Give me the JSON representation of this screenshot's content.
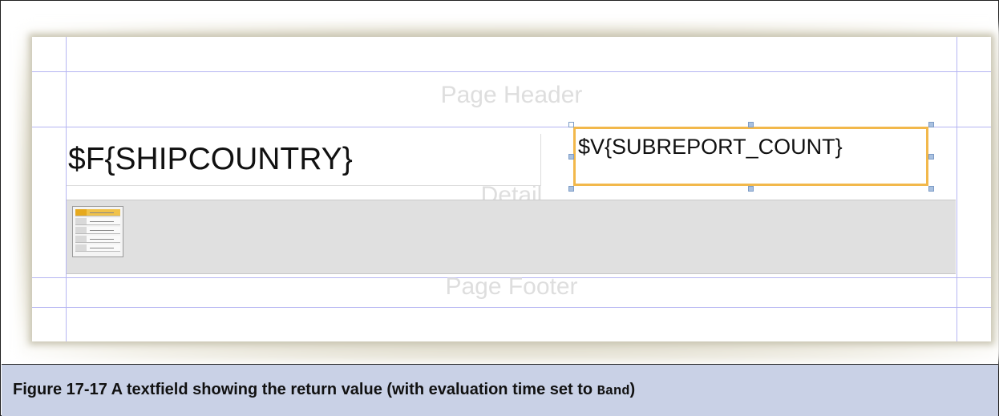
{
  "designer": {
    "bands": {
      "page_header": "Page Header",
      "detail": "Detail",
      "page_footer": "Page Footer"
    },
    "fields": {
      "ship_country": "$F{SHIPCOUNTRY}",
      "subreport_count": "$V{SUBREPORT_COUNT}"
    },
    "subreport_element": "subreport-icon",
    "selection_color": "#f2b84b",
    "guide_color": "#b5b5f2"
  },
  "caption": {
    "prefix": "Figure 17-17  A textfield showing the return value (with evaluation time set to ",
    "code": "Band",
    "suffix": ")"
  }
}
